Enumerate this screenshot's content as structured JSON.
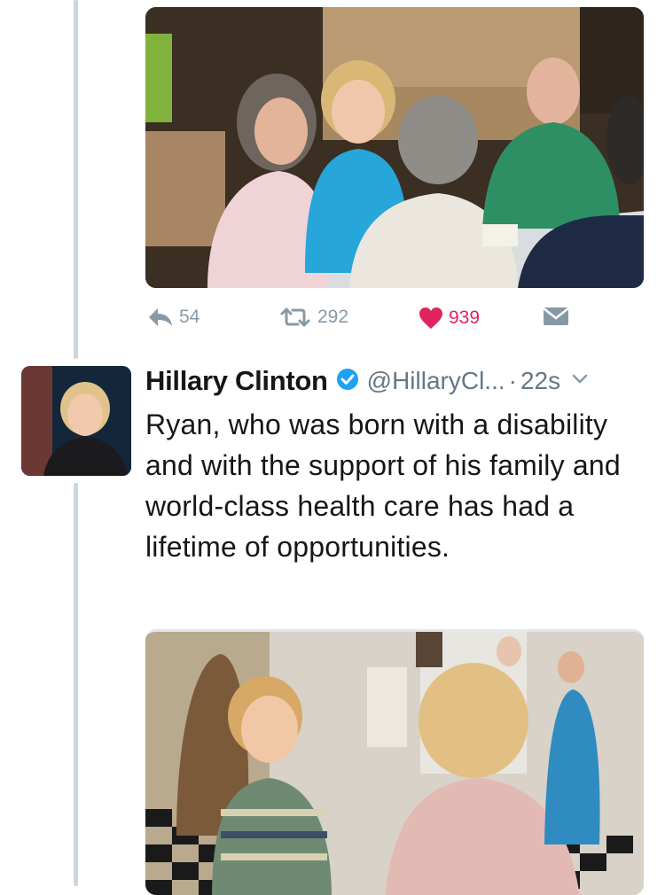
{
  "tweet_prev": {
    "image_alt": "",
    "actions": {
      "reply_count": "54",
      "retweet_count": "292",
      "like_count": "939"
    }
  },
  "tweet": {
    "author_name": "Hillary Clinton",
    "handle": "@HillaryCl...",
    "separator": "·",
    "timestamp": "22s",
    "text": "Ryan, who was born with a disability and with the support of his family and world-class health care has had a lifetime of opportunities."
  },
  "icons": {
    "reply": "reply-icon",
    "retweet": "retweet-icon",
    "like": "heart-icon",
    "dm": "envelope-icon",
    "verified": "verified-badge-icon",
    "caret": "chevron-down-icon"
  },
  "colors": {
    "like": "#e0245e",
    "verified": "#1da1f2",
    "muted": "#8899a6",
    "thread_line": "#ccd6dd"
  }
}
